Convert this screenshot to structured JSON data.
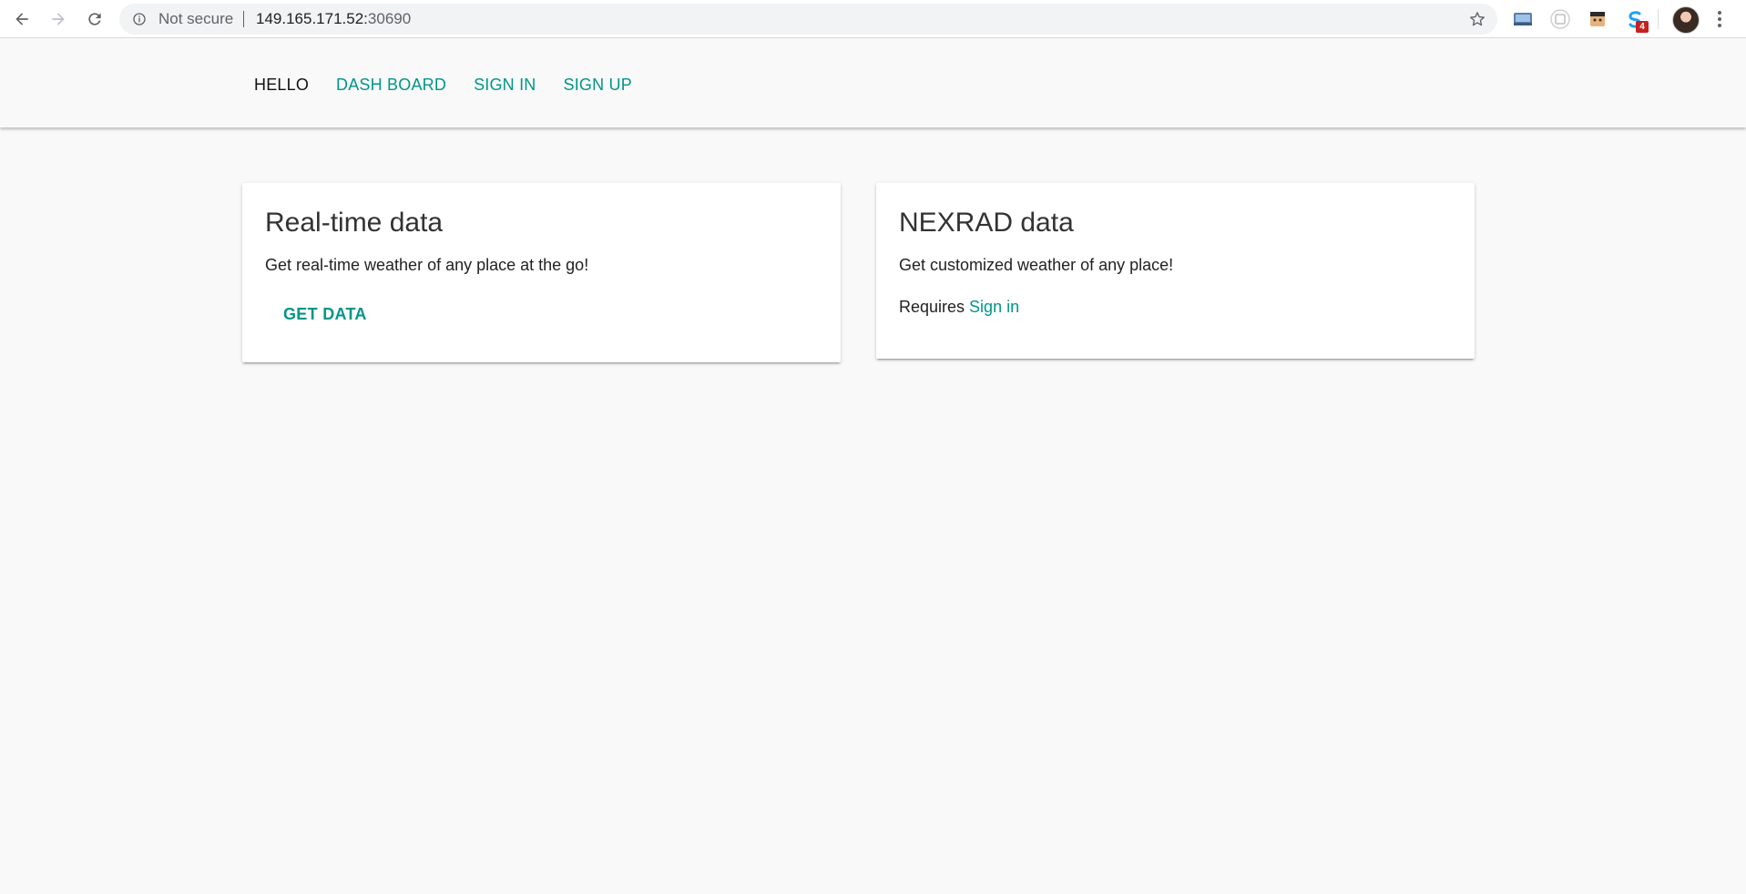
{
  "browser": {
    "security_label": "Not secure",
    "url_host": "149.165.171.52:",
    "url_port": "30690",
    "extension_badge": "4"
  },
  "header": {
    "brand": "HELLO",
    "links": [
      "DASH BOARD",
      "SIGN IN",
      "SIGN UP"
    ]
  },
  "cards": {
    "realtime": {
      "title": "Real-time data",
      "text": "Get real-time weather of any place at the go!",
      "action": "GET DATA"
    },
    "nexrad": {
      "title": "NEXRAD data",
      "text": "Get customized weather of any place!",
      "requires_prefix": "Requires ",
      "requires_link": "Sign in"
    }
  },
  "colors": {
    "accent": "#009688",
    "background": "#f9f9f9"
  }
}
